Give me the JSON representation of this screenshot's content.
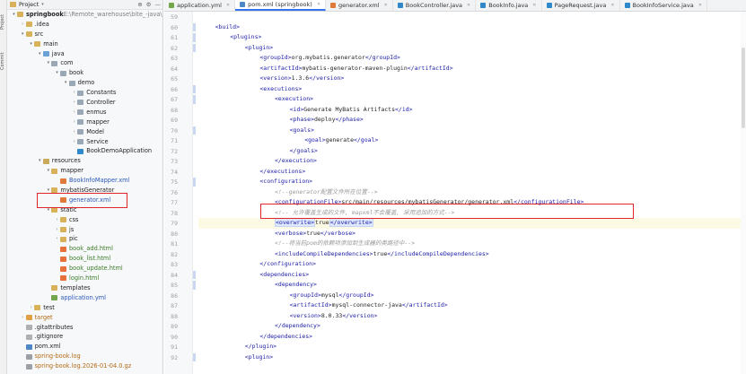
{
  "left_strip": {
    "project_label": "Project",
    "commit_label": "Commit"
  },
  "project_panel": {
    "title": "Project",
    "header_icons": [
      "target-icon",
      "gear-icon",
      "minimize-icon"
    ],
    "tree": [
      {
        "indent": 0,
        "chev": "▾",
        "icon": "folder",
        "label": "springbook",
        "suffix": " E:\\Remote_warehouse\\bite_-java\\sp",
        "cls": "txt-bold"
      },
      {
        "indent": 1,
        "chev": "›",
        "icon": "folder",
        "label": ".idea",
        "cls": ""
      },
      {
        "indent": 1,
        "chev": "▾",
        "icon": "folder",
        "label": "src",
        "cls": ""
      },
      {
        "indent": 2,
        "chev": "▾",
        "icon": "folder",
        "label": "main",
        "cls": ""
      },
      {
        "indent": 3,
        "chev": "▾",
        "icon": "folder src",
        "label": "java",
        "cls": ""
      },
      {
        "indent": 4,
        "chev": "▾",
        "icon": "pkg",
        "label": "com",
        "cls": ""
      },
      {
        "indent": 5,
        "chev": "▾",
        "icon": "pkg",
        "label": "book",
        "cls": ""
      },
      {
        "indent": 6,
        "chev": "▾",
        "icon": "pkg",
        "label": "demo",
        "cls": ""
      },
      {
        "indent": 7,
        "chev": "›",
        "icon": "pkg",
        "label": "Constants",
        "cls": ""
      },
      {
        "indent": 7,
        "chev": "›",
        "icon": "pkg",
        "label": "Controller",
        "cls": ""
      },
      {
        "indent": 7,
        "chev": "›",
        "icon": "pkg",
        "label": "enmus",
        "cls": ""
      },
      {
        "indent": 7,
        "chev": "›",
        "icon": "pkg",
        "label": "mapper",
        "cls": ""
      },
      {
        "indent": 7,
        "chev": "›",
        "icon": "pkg",
        "label": "Model",
        "cls": ""
      },
      {
        "indent": 7,
        "chev": "›",
        "icon": "pkg",
        "label": "Service",
        "cls": ""
      },
      {
        "indent": 7,
        "chev": "",
        "icon": "file-java",
        "label": "BookDemoApplication",
        "cls": ""
      },
      {
        "indent": 3,
        "chev": "▾",
        "icon": "folder res",
        "label": "resources",
        "cls": ""
      },
      {
        "indent": 4,
        "chev": "▾",
        "icon": "folder",
        "label": "mapper",
        "cls": ""
      },
      {
        "indent": 5,
        "chev": "",
        "icon": "file-xml",
        "label": "BookInfoMapper.xml",
        "cls": "txt-blue"
      },
      {
        "indent": 4,
        "chev": "▾",
        "icon": "folder",
        "label": "mybatisGenerator",
        "cls": ""
      },
      {
        "indent": 5,
        "chev": "",
        "icon": "file-xml",
        "label": "generator.xml",
        "cls": "txt-blue"
      },
      {
        "indent": 4,
        "chev": "▾",
        "icon": "folder",
        "label": "static",
        "cls": ""
      },
      {
        "indent": 5,
        "chev": "›",
        "icon": "folder",
        "label": "css",
        "cls": ""
      },
      {
        "indent": 5,
        "chev": "›",
        "icon": "folder",
        "label": "js",
        "cls": ""
      },
      {
        "indent": 5,
        "chev": "›",
        "icon": "folder",
        "label": "pic",
        "cls": ""
      },
      {
        "indent": 5,
        "chev": "",
        "icon": "file-html",
        "label": "book_add.html",
        "cls": "txt-green"
      },
      {
        "indent": 5,
        "chev": "",
        "icon": "file-html",
        "label": "book_list.html",
        "cls": "txt-green"
      },
      {
        "indent": 5,
        "chev": "",
        "icon": "file-html",
        "label": "book_update.html",
        "cls": "txt-green"
      },
      {
        "indent": 5,
        "chev": "",
        "icon": "file-html",
        "label": "login.html",
        "cls": "txt-green"
      },
      {
        "indent": 4,
        "chev": "",
        "icon": "folder",
        "label": "templates",
        "cls": ""
      },
      {
        "indent": 4,
        "chev": "",
        "icon": "file-yml",
        "label": "application.yml",
        "cls": "txt-blue"
      },
      {
        "indent": 2,
        "chev": "›",
        "icon": "folder",
        "label": "test",
        "cls": ""
      },
      {
        "indent": 1,
        "chev": "›",
        "icon": "folder excl",
        "label": "target",
        "cls": "txt-orange"
      },
      {
        "indent": 1,
        "chev": "",
        "icon": "file-git",
        "label": ".gitattributes",
        "cls": ""
      },
      {
        "indent": 1,
        "chev": "",
        "icon": "file-git",
        "label": ".gitignore",
        "cls": ""
      },
      {
        "indent": 1,
        "chev": "",
        "icon": "file-pom",
        "label": "pom.xml",
        "cls": ""
      },
      {
        "indent": 1,
        "chev": "",
        "icon": "file-log",
        "label": "spring-book.log",
        "cls": "txt-orange"
      },
      {
        "indent": 1,
        "chev": "",
        "icon": "file-log",
        "label": "spring-book.log.2026-01-04.0.gz",
        "cls": "txt-orange"
      }
    ]
  },
  "tabs": [
    {
      "label": "application.yml",
      "icon": "file-yml",
      "active": false
    },
    {
      "label": "pom.xml (springbook)",
      "icon": "file-pom",
      "active": true
    },
    {
      "label": "generator.xml",
      "icon": "file-xml",
      "active": false
    },
    {
      "label": "BookController.java",
      "icon": "file-java",
      "active": false
    },
    {
      "label": "BookInfo.java",
      "icon": "file-java",
      "active": false
    },
    {
      "label": "PageRequest.java",
      "icon": "file-java",
      "active": false
    },
    {
      "label": "BookInfoService.java",
      "icon": "file-java",
      "active": false
    }
  ],
  "editor": {
    "current_line": 79,
    "lines": [
      {
        "n": 59,
        "indent": 0,
        "parts": []
      },
      {
        "n": 60,
        "indent": 1,
        "parts": [
          [
            "tag",
            "<build>"
          ]
        ]
      },
      {
        "n": 61,
        "indent": 2,
        "parts": [
          [
            "tag",
            "<plugins>"
          ]
        ]
      },
      {
        "n": 62,
        "indent": 3,
        "parts": [
          [
            "tag",
            "<plugin>"
          ]
        ]
      },
      {
        "n": 63,
        "indent": 4,
        "parts": [
          [
            "tag",
            "<groupId>"
          ],
          [
            "val",
            "org.mybatis.generator"
          ],
          [
            "tag",
            "</groupId>"
          ]
        ]
      },
      {
        "n": 64,
        "indent": 4,
        "parts": [
          [
            "tag",
            "<artifactId>"
          ],
          [
            "val",
            "mybatis-generator-maven-plugin"
          ],
          [
            "tag",
            "</artifactId>"
          ]
        ]
      },
      {
        "n": 65,
        "indent": 4,
        "parts": [
          [
            "tag",
            "<version>"
          ],
          [
            "val",
            "1.3.6"
          ],
          [
            "tag",
            "</version>"
          ]
        ]
      },
      {
        "n": 66,
        "indent": 4,
        "parts": [
          [
            "tag",
            "<executions>"
          ]
        ]
      },
      {
        "n": 67,
        "indent": 5,
        "parts": [
          [
            "tag",
            "<execution>"
          ]
        ]
      },
      {
        "n": 68,
        "indent": 6,
        "parts": [
          [
            "tag",
            "<id>"
          ],
          [
            "val",
            "Generate MyBatis Artifacts"
          ],
          [
            "tag",
            "</id>"
          ]
        ]
      },
      {
        "n": 69,
        "indent": 6,
        "parts": [
          [
            "tag",
            "<phase>"
          ],
          [
            "val",
            "deploy"
          ],
          [
            "tag",
            "</phase>"
          ]
        ]
      },
      {
        "n": 70,
        "indent": 6,
        "parts": [
          [
            "tag",
            "<goals>"
          ]
        ]
      },
      {
        "n": 71,
        "indent": 7,
        "parts": [
          [
            "tag",
            "<goal>"
          ],
          [
            "val",
            "generate"
          ],
          [
            "tag",
            "</goal>"
          ]
        ]
      },
      {
        "n": 72,
        "indent": 6,
        "parts": [
          [
            "tag",
            "</goals>"
          ]
        ]
      },
      {
        "n": 73,
        "indent": 5,
        "parts": [
          [
            "tag",
            "</execution>"
          ]
        ]
      },
      {
        "n": 74,
        "indent": 4,
        "parts": [
          [
            "tag",
            "</executions>"
          ]
        ]
      },
      {
        "n": 75,
        "indent": 4,
        "parts": [
          [
            "tag",
            "<configuration>"
          ]
        ]
      },
      {
        "n": 76,
        "indent": 5,
        "parts": [
          [
            "cmt",
            "<!--generator配置文件所在位置-->"
          ]
        ]
      },
      {
        "n": 77,
        "indent": 5,
        "parts": [
          [
            "tag",
            "<configurationFile>"
          ],
          [
            "val",
            "src/main/resources/mybatisGenerator/generator.xml"
          ],
          [
            "tag",
            "</configurationFile>"
          ]
        ]
      },
      {
        "n": 78,
        "indent": 5,
        "parts": [
          [
            "cmt",
            "<!-- 允许覆盖生成的文件, mapxml不会覆盖, 采用追加的方式-->"
          ]
        ]
      },
      {
        "n": 79,
        "indent": 5,
        "parts": [
          [
            "hl",
            "<overwrite>"
          ],
          [
            "val",
            "true"
          ],
          [
            "hl",
            "</overwrite>"
          ]
        ]
      },
      {
        "n": 80,
        "indent": 5,
        "parts": [
          [
            "tag",
            "<verbose>"
          ],
          [
            "val",
            "true"
          ],
          [
            "tag",
            "</verbose>"
          ]
        ]
      },
      {
        "n": 81,
        "indent": 5,
        "parts": [
          [
            "cmt",
            "<!--将当前pom的依赖项添加到生成器的类路径中-->"
          ]
        ]
      },
      {
        "n": 82,
        "indent": 5,
        "parts": [
          [
            "tag",
            "<includeCompileDependencies>"
          ],
          [
            "val",
            "true"
          ],
          [
            "tag",
            "</includeCompileDependencies>"
          ]
        ]
      },
      {
        "n": 83,
        "indent": 4,
        "parts": [
          [
            "tag",
            "</configuration>"
          ]
        ]
      },
      {
        "n": 84,
        "indent": 4,
        "parts": [
          [
            "tag",
            "<dependencies>"
          ]
        ]
      },
      {
        "n": 85,
        "indent": 5,
        "parts": [
          [
            "tag",
            "<dependency>"
          ]
        ]
      },
      {
        "n": 86,
        "indent": 6,
        "parts": [
          [
            "tag",
            "<groupId>"
          ],
          [
            "val",
            "mysql"
          ],
          [
            "tag",
            "</groupId>"
          ]
        ]
      },
      {
        "n": 87,
        "indent": 6,
        "parts": [
          [
            "tag",
            "<artifactId>"
          ],
          [
            "val",
            "mysql-connector-java"
          ],
          [
            "tag",
            "</artifactId>"
          ]
        ]
      },
      {
        "n": 88,
        "indent": 6,
        "parts": [
          [
            "tag",
            "<version>"
          ],
          [
            "val",
            "8.0.33"
          ],
          [
            "tag",
            "</version>"
          ]
        ]
      },
      {
        "n": 89,
        "indent": 5,
        "parts": [
          [
            "tag",
            "</dependency>"
          ]
        ]
      },
      {
        "n": 90,
        "indent": 4,
        "parts": [
          [
            "tag",
            "</dependencies>"
          ]
        ]
      },
      {
        "n": 91,
        "indent": 3,
        "parts": [
          [
            "tag",
            "</plugin>"
          ]
        ]
      },
      {
        "n": 92,
        "indent": 3,
        "parts": [
          [
            "tag",
            "<plugin>"
          ]
        ]
      }
    ]
  },
  "colors": {
    "accent": "#3574f0",
    "highlight_box": "#e0262b",
    "xml_tag": "#1a1aa6",
    "comment": "#9a9a9a"
  }
}
